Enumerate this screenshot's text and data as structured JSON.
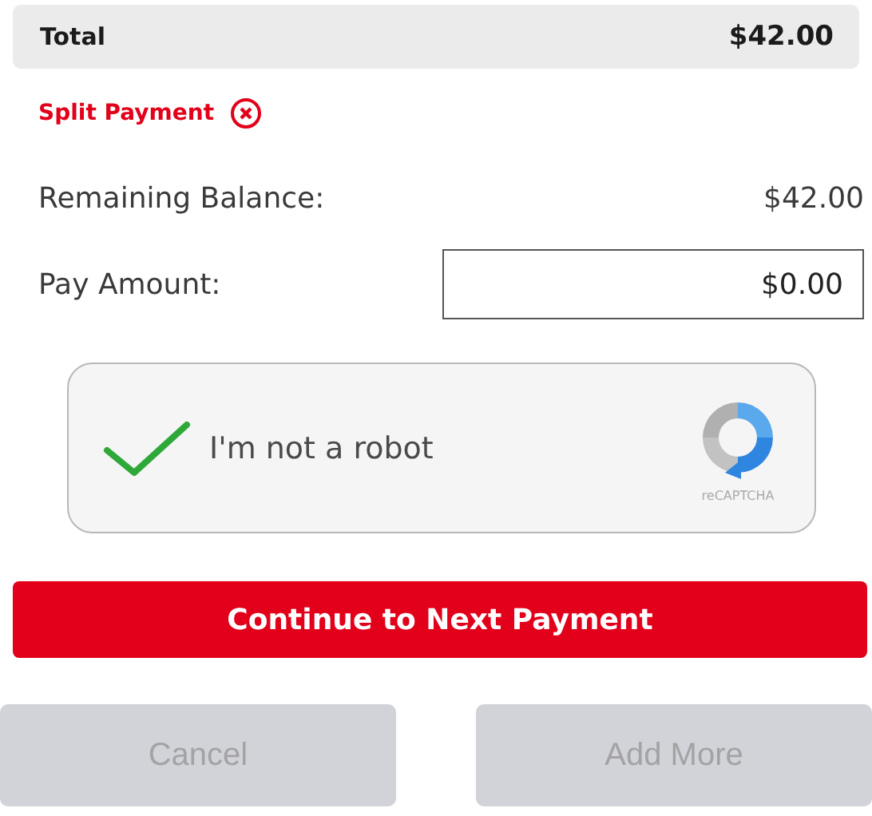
{
  "total": {
    "label": "Total",
    "amount": "$42.00"
  },
  "split_payment": {
    "label": "Split Payment"
  },
  "rows": [
    {
      "label": "Remaining Balance:",
      "value": "$42.00",
      "kind": "text"
    },
    {
      "label": "Pay Amount:",
      "value": "$0.00",
      "kind": "field"
    }
  ],
  "captcha": {
    "label": "I'm not a robot",
    "checked": true,
    "brand": "reCAPTCHA"
  },
  "primary_button": "Continue to Next Payment",
  "buttons": [
    {
      "label": "Cancel",
      "disabled": true
    },
    {
      "label": "Add More",
      "disabled": true
    }
  ]
}
